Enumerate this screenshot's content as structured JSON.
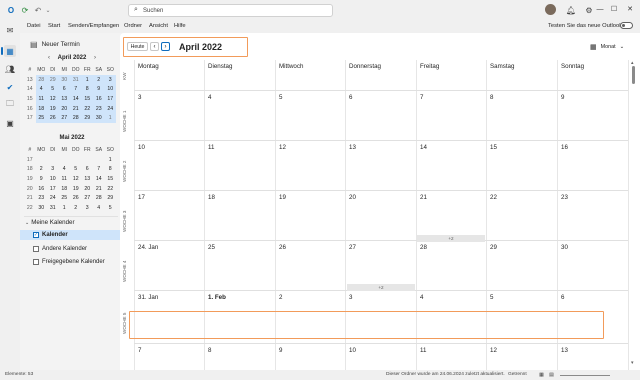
{
  "titlebar": {
    "search_placeholder": "Suchen",
    "icons": [
      "outlook-logo",
      "sync-icon",
      "undo-icon",
      "avatar",
      "bell-icon",
      "settings-icon",
      "minimize",
      "maximize",
      "close"
    ]
  },
  "menu": {
    "items": [
      "Datei",
      "Start",
      "Senden/Empfangen",
      "Ordner",
      "Ansicht",
      "Hilfe"
    ],
    "toggle_label": "Testen Sie das neue Outlook"
  },
  "pane": {
    "new_event": "Neuer Termin",
    "april": {
      "title": "April 2022",
      "headers": [
        "#",
        "MO",
        "DI",
        "MI",
        "DO",
        "FR",
        "SA",
        "SO"
      ],
      "rows": [
        [
          "13",
          "28",
          "29",
          "30",
          "31",
          "1",
          "2",
          "3"
        ],
        [
          "14",
          "4",
          "5",
          "6",
          "7",
          "8",
          "9",
          "10"
        ],
        [
          "15",
          "11",
          "12",
          "13",
          "14",
          "15",
          "16",
          "17"
        ],
        [
          "16",
          "18",
          "19",
          "20",
          "21",
          "22",
          "23",
          "24"
        ],
        [
          "17",
          "25",
          "26",
          "27",
          "28",
          "29",
          "30",
          "1"
        ]
      ]
    },
    "may": {
      "title": "Mai 2022",
      "headers": [
        "#",
        "MO",
        "DI",
        "MI",
        "DO",
        "FR",
        "SA",
        "SO"
      ],
      "rows": [
        [
          "17",
          "",
          "",
          "",
          "",
          "",
          "",
          "1"
        ],
        [
          "18",
          "2",
          "3",
          "4",
          "5",
          "6",
          "7",
          "8"
        ],
        [
          "19",
          "9",
          "10",
          "11",
          "12",
          "13",
          "14",
          "15"
        ],
        [
          "20",
          "16",
          "17",
          "18",
          "19",
          "20",
          "21",
          "22"
        ],
        [
          "21",
          "23",
          "24",
          "25",
          "26",
          "27",
          "28",
          "29"
        ],
        [
          "22",
          "30",
          "31",
          "1",
          "2",
          "3",
          "4",
          "5"
        ]
      ]
    },
    "my_calendars": "Meine Kalender",
    "calendars": [
      "Kalender",
      "Andere Kalender",
      "Freigegebene Kalender"
    ]
  },
  "calendar": {
    "today": "Heute",
    "title": "April 2022",
    "view": "Monat",
    "day_headers": [
      "Montag",
      "Dienstag",
      "Mittwoch",
      "Donnerstag",
      "Freitag",
      "Samstag",
      "Sonntag"
    ],
    "week_labels": [
      "KW",
      "WOCHE 1",
      "WOCHE 2",
      "WOCHE 3",
      "WOCHE 4",
      "WOCHE 5"
    ],
    "weeks": [
      [
        "3",
        "4",
        "5",
        "6",
        "7",
        "8",
        "9"
      ],
      [
        "10",
        "11",
        "12",
        "13",
        "14",
        "15",
        "16"
      ],
      [
        "17",
        "18",
        "19",
        "20",
        "21",
        "22",
        "23"
      ],
      [
        "24. Jan",
        "25",
        "26",
        "27",
        "28",
        "29",
        "30"
      ],
      [
        "31. Jan",
        "1. Feb",
        "2",
        "3",
        "4",
        "5",
        "6"
      ],
      [
        "7",
        "8",
        "9",
        "10",
        "11",
        "12",
        "13"
      ]
    ],
    "more_labels": [
      "+2",
      "+2"
    ]
  },
  "status": {
    "items": "Elemente: 53",
    "updated": "Dieser Ordner wurde am 24.06.2024 zuletzt aktualisiert.",
    "sync": "Getrennt"
  }
}
